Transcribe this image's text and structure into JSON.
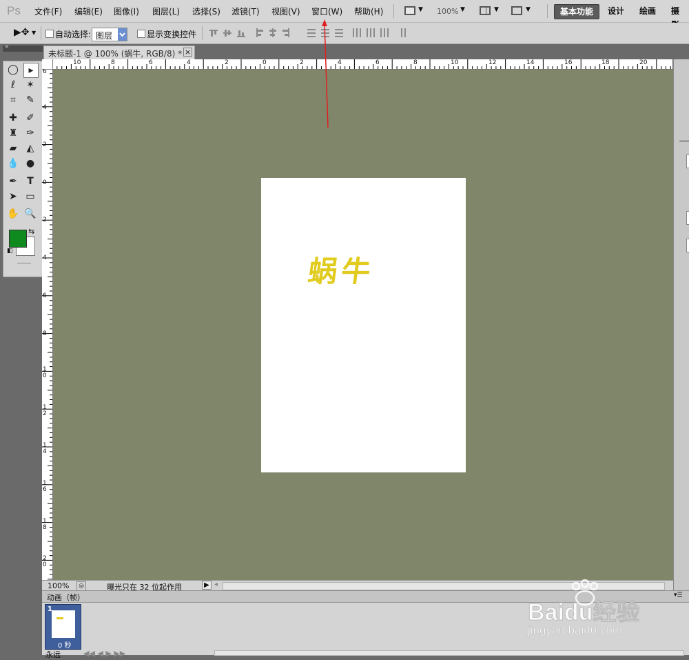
{
  "app": {
    "logo": "Ps"
  },
  "menu": {
    "items": [
      "文件(F)",
      "编辑(E)",
      "图像(I)",
      "图层(L)",
      "选择(S)",
      "滤镜(T)",
      "视图(V)",
      "窗口(W)",
      "帮助(H)"
    ],
    "zoom": "100%",
    "workspaces": [
      "基本功能",
      "设计",
      "绘画",
      "摄影"
    ]
  },
  "options": {
    "auto_select_label": "自动选择:",
    "layer_select_value": "图层",
    "show_transform_label": "显示变换控件"
  },
  "document": {
    "tab_title": "未标题-1 @ 100% (蜗牛, RGB/8) *",
    "canvas_text": "蜗牛",
    "hruler_labels": [
      "10",
      "8",
      "6",
      "4",
      "2",
      "0",
      "2",
      "4",
      "6",
      "8",
      "10",
      "12",
      "14",
      "16",
      "18",
      "20"
    ],
    "vruler_labels": [
      "6",
      "4",
      "2",
      "0",
      "2",
      "4",
      "6",
      "8",
      "10",
      "12",
      "14",
      "16",
      "18",
      "20"
    ]
  },
  "status": {
    "zoom": "100%",
    "message": "曝光只在 32 位起作用"
  },
  "animation": {
    "panel_title": "动画（帧）",
    "frame_number": "1",
    "frame_delay": "0 秒",
    "loop": "永远"
  },
  "colors": {
    "canvas_bg": "#80866a",
    "text_color": "#e0cb1e",
    "foreground": "#0f8a1e",
    "background": "#ffffff",
    "annotation_arrow": "#e02020"
  },
  "watermark": {
    "brand": "Baidu经验",
    "url": "jingyan.baidu.com"
  }
}
